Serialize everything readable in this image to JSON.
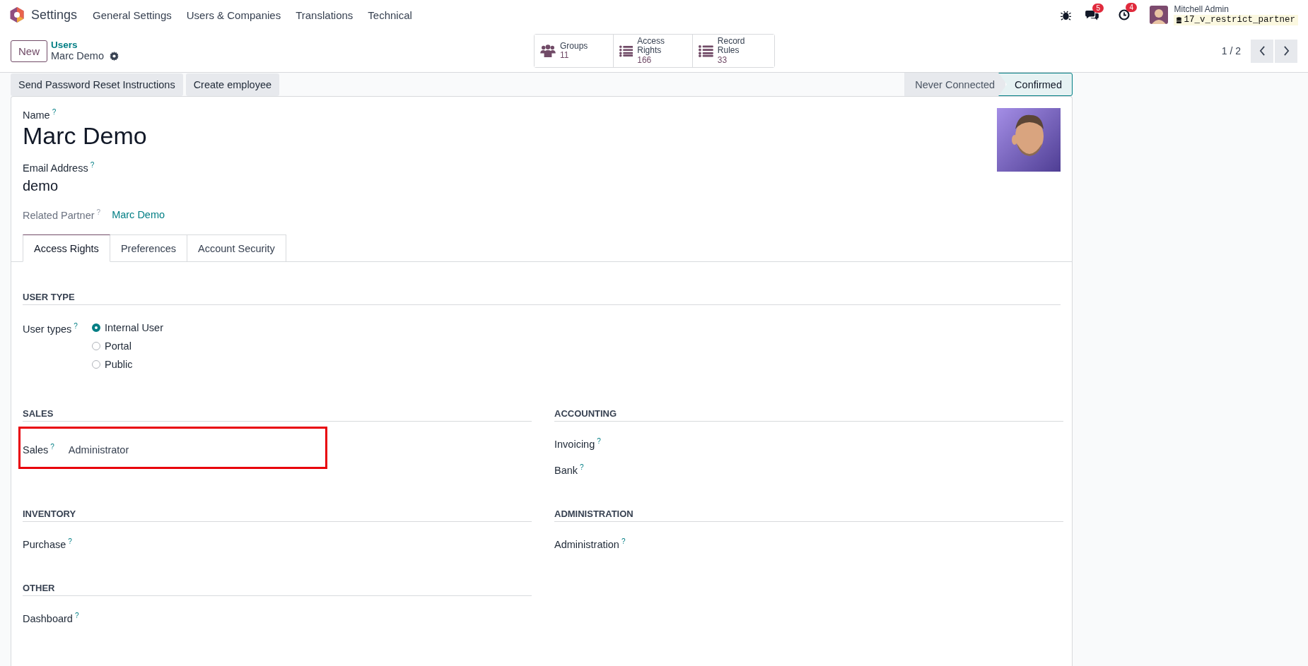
{
  "navbar": {
    "app": "Settings",
    "menu": [
      "General Settings",
      "Users & Companies",
      "Translations",
      "Technical"
    ],
    "systray": {
      "messages_count": "5",
      "activities_count": "4",
      "user_name": "Mitchell Admin",
      "database": "17_v_restrict_partner"
    }
  },
  "control_panel": {
    "new_button": "New",
    "breadcrumb": "Users",
    "record": "Marc Demo",
    "smart_buttons": [
      {
        "kind": "groups",
        "label": "Groups",
        "value": "11"
      },
      {
        "kind": "list",
        "label": "Access Rights",
        "value": "166"
      },
      {
        "kind": "list",
        "label": "Record Rules",
        "value": "33"
      }
    ],
    "pager": "1 / 2"
  },
  "status_bar": {
    "buttons": [
      "Send Password Reset Instructions",
      "Create employee"
    ],
    "stages": [
      {
        "label": "Never Connected",
        "selected": false
      },
      {
        "label": "Confirmed",
        "selected": true
      }
    ]
  },
  "form": {
    "name": {
      "label": "Name",
      "help": "?",
      "value": "Marc Demo"
    },
    "email": {
      "label": "Email Address",
      "help": "?",
      "value": "demo"
    },
    "partner": {
      "label": "Related Partner",
      "help": "?",
      "value": "Marc Demo"
    },
    "tabs": [
      {
        "label": "Access Rights",
        "selected": true
      },
      {
        "label": "Preferences",
        "selected": false
      },
      {
        "label": "Account Security",
        "selected": false
      }
    ],
    "user_type": {
      "title": "USER TYPE",
      "label": "User types",
      "help": "?",
      "options": [
        {
          "label": "Internal User",
          "selected": true
        },
        {
          "label": "Portal",
          "selected": false
        },
        {
          "label": "Public",
          "selected": false
        }
      ]
    },
    "groups": [
      {
        "title": "SALES",
        "fields": [
          {
            "label": "Sales",
            "help": "?",
            "value": "Administrator",
            "highlighted": true
          }
        ]
      },
      {
        "title": "ACCOUNTING",
        "fields": [
          {
            "label": "Invoicing",
            "help": "?",
            "highlighted": false
          },
          {
            "label": "Bank",
            "help": "?",
            "highlighted": false
          }
        ]
      },
      {
        "title": "INVENTORY",
        "fields": [
          {
            "label": "Purchase",
            "help": "?",
            "highlighted": false
          }
        ]
      },
      {
        "title": "ADMINISTRATION",
        "fields": [
          {
            "label": "Administration",
            "help": "?",
            "highlighted": false
          }
        ]
      },
      {
        "title": "OTHER",
        "fields": [
          {
            "label": "Dashboard",
            "help": "?",
            "highlighted": false
          }
        ]
      }
    ]
  }
}
